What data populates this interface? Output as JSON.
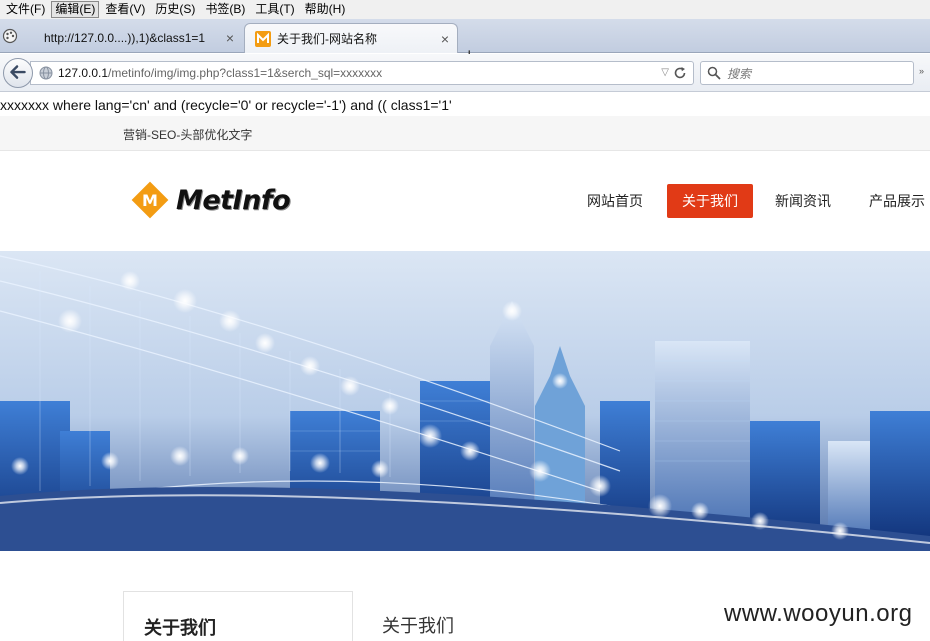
{
  "browser": {
    "menu": [
      "文件(F)",
      "编辑(E)",
      "查看(V)",
      "历史(S)",
      "书签(B)",
      "工具(T)",
      "帮助(H)"
    ],
    "tabs": [
      {
        "title": "http://127.0.0....)),1)&class1=1"
      },
      {
        "title": "关于我们-网站名称"
      }
    ],
    "new_tab": "+",
    "tab_close": "×",
    "url_host": "127.0.0.1",
    "url_path": "/metinfo/img/img.php?class1=1&serch_sql=xxxxxxx",
    "search_placeholder": "搜索"
  },
  "page": {
    "sql_output": "xxxxxxx where lang='cn' and (recycle='0' or recycle='-1') and (( class1='1'",
    "top_strip_text": "营销-SEO-头部优化文字",
    "logo_text": "MetInfo",
    "logo_mark_letter": "M",
    "nav": [
      "网站首页",
      "关于我们",
      "新闻资讯",
      "产品展示"
    ],
    "active_nav": "关于我们",
    "side_title": "关于我们",
    "main_title": "关于我们",
    "watermark": "www.wooyun.org"
  },
  "colors": {
    "accent": "#e13a16",
    "logo_orange": "#f39c12"
  }
}
